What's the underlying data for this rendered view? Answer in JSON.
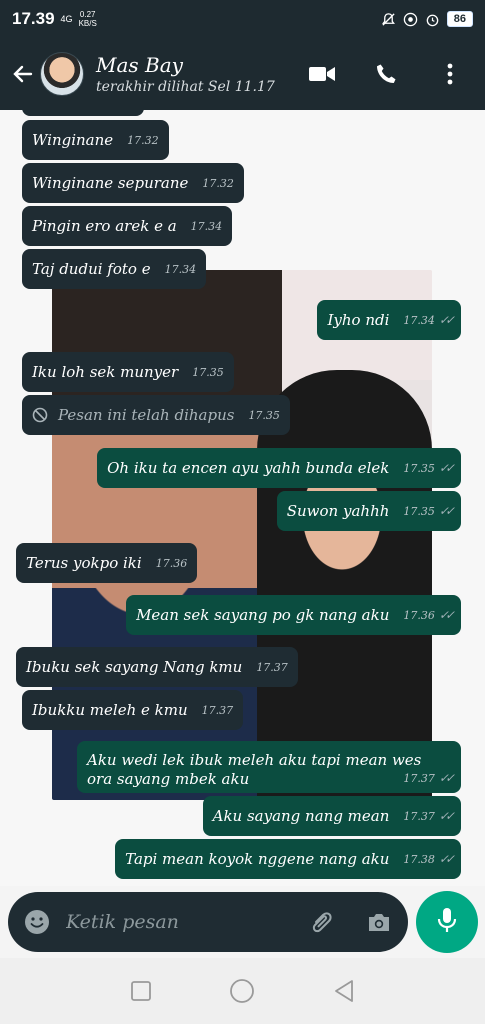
{
  "status_bar": {
    "time": "17.39",
    "network_label": "4G",
    "speed_value": "0.27",
    "speed_unit": "KB/S",
    "battery": "86",
    "icons": [
      "mute-icon",
      "at-icon",
      "alarm-icon",
      "battery-icon"
    ]
  },
  "header": {
    "contact_name": "Mas Bay",
    "contact_status": "terakhir dilihat Sel 11.17",
    "icons": [
      "back-arrow-icon",
      "video-call-icon",
      "phone-icon",
      "more-vert-icon"
    ]
  },
  "messages": [
    {
      "dir": "in",
      "text": "Winginane",
      "time": "17.32"
    },
    {
      "dir": "in",
      "text": "Winginane sepurane",
      "time": "17.32"
    },
    {
      "dir": "in",
      "text": "Pingin ero arek e a",
      "time": "17.34"
    },
    {
      "dir": "in",
      "text": "Taj dudui foto e",
      "time": "17.34"
    },
    {
      "dir": "out",
      "text": "Iyho ndi",
      "time": "17.34"
    },
    {
      "dir": "in",
      "text": "Iku loh sek munyer",
      "time": "17.35"
    },
    {
      "dir": "in",
      "text": "Pesan ini telah dihapus",
      "time": "17.35",
      "deleted": true
    },
    {
      "dir": "out",
      "text": "Oh iku ta encen ayu yahh bunda elek",
      "time": "17.35"
    },
    {
      "dir": "out",
      "text": "Suwon yahhh",
      "time": "17.35"
    },
    {
      "dir": "in",
      "text": "Terus yokpo iki",
      "time": "17.36"
    },
    {
      "dir": "out",
      "text": "Mean sek sayang po gk nang aku",
      "time": "17.36"
    },
    {
      "dir": "in",
      "text": "Ibuku sek sayang Nang kmu",
      "time": "17.37"
    },
    {
      "dir": "in",
      "text": "Ibukku meleh e kmu",
      "time": "17.37"
    },
    {
      "dir": "out",
      "text": "Aku wedi lek ibuk meleh aku tapi mean wes ora sayang mbek aku",
      "time": "17.37"
    },
    {
      "dir": "out",
      "text": "Aku sayang nang mean",
      "time": "17.37"
    },
    {
      "dir": "out",
      "text": "Tapi mean koyok nggene nang aku",
      "time": "17.38"
    }
  ],
  "input": {
    "placeholder": "Ketik pesan",
    "icons": [
      "emoji-icon",
      "attach-icon",
      "camera-icon",
      "mic-icon"
    ]
  },
  "nav": {
    "icons": [
      "recents-square-icon",
      "home-circle-icon",
      "back-triangle-icon"
    ]
  },
  "colors": {
    "header_bg": "#1e2a30",
    "incoming_bubble": "#1f2c33",
    "outgoing_bubble": "#0b4d40",
    "accent": "#00a884"
  }
}
